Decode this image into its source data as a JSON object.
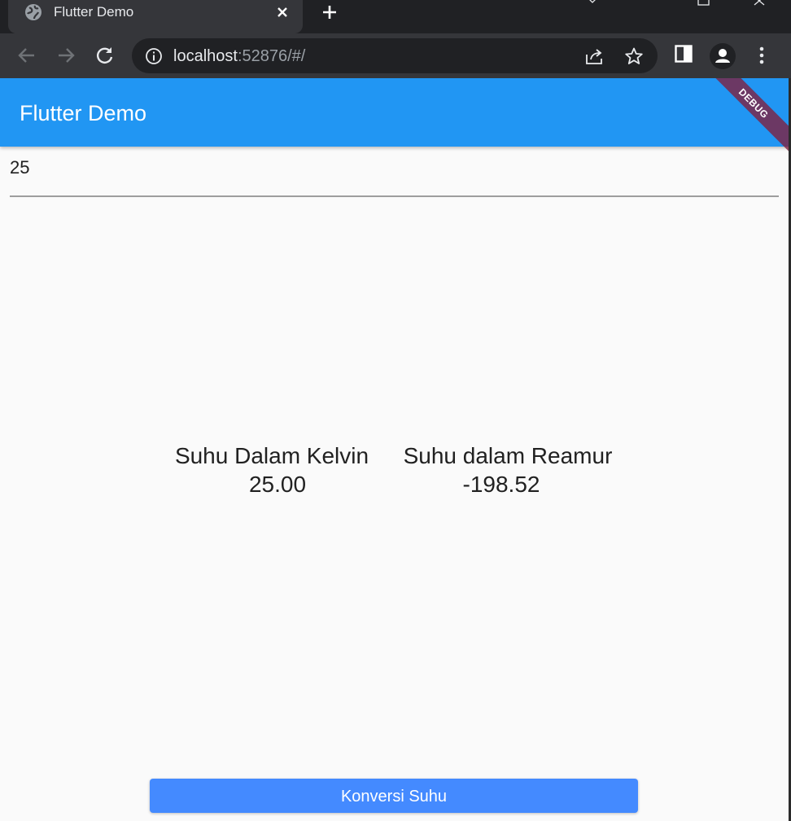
{
  "browser": {
    "tab": {
      "title": "Flutter Demo",
      "favicon": "globe-icon"
    },
    "address_bar": {
      "host": "localhost",
      "rest": ":52876/#/"
    },
    "colors": {
      "frame": "#202124",
      "toolbar": "#35363a",
      "text": "#e8eaed",
      "muted": "#9aa0a6"
    }
  },
  "app": {
    "appbar": {
      "title": "Flutter Demo",
      "debug_label": "DEBUG"
    },
    "input": {
      "value": "25"
    },
    "results": {
      "kelvin": {
        "label": "Suhu Dalam Kelvin",
        "value": "25.00"
      },
      "reamur": {
        "label": "Suhu dalam Reamur",
        "value": "-198.52"
      }
    },
    "button": {
      "label": "Konversi Suhu"
    },
    "colors": {
      "primary": "#2196f3",
      "button": "#448aff",
      "background": "#fafafa",
      "debug_banner": "#802040"
    }
  }
}
